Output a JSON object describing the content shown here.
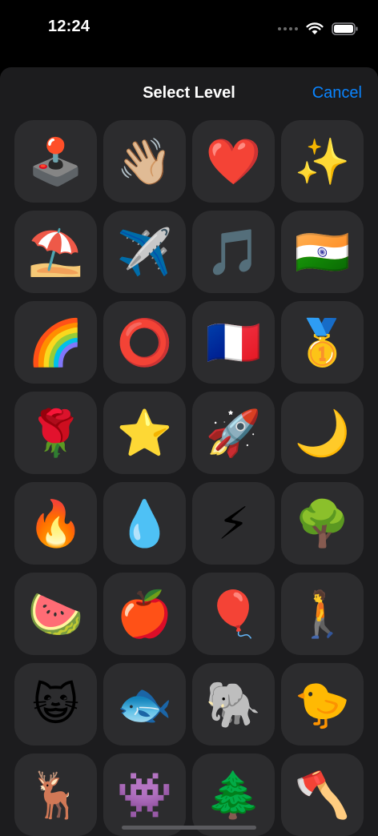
{
  "status_bar": {
    "time": "12:24",
    "icons": [
      "signal-dots-icon",
      "wifi-icon",
      "battery-icon"
    ]
  },
  "sheet": {
    "title": "Select Level",
    "cancel_label": "Cancel",
    "accent_color": "#0a84ff"
  },
  "levels": [
    {
      "emoji": "🕹️",
      "icon": "joystick-icon"
    },
    {
      "emoji": "👋🏼",
      "icon": "waving-hand-icon"
    },
    {
      "emoji": "❤️",
      "icon": "red-heart-icon"
    },
    {
      "emoji": "✨",
      "icon": "sparkles-icon"
    },
    {
      "emoji": "⛱️",
      "icon": "beach-umbrella-icon"
    },
    {
      "emoji": "✈️",
      "icon": "airplane-icon"
    },
    {
      "emoji": "🎵",
      "icon": "musical-note-icon"
    },
    {
      "emoji": "🇮🇳",
      "icon": "india-flag-icon"
    },
    {
      "emoji": "🌈",
      "icon": "rainbow-icon"
    },
    {
      "emoji": "⭕",
      "icon": "red-circle-icon"
    },
    {
      "emoji": "🇫🇷",
      "icon": "france-flag-icon"
    },
    {
      "emoji": "🥇",
      "icon": "gold-medal-icon"
    },
    {
      "emoji": "🌹",
      "icon": "rose-icon"
    },
    {
      "emoji": "⭐",
      "icon": "star-icon"
    },
    {
      "emoji": "🚀",
      "icon": "rocket-icon"
    },
    {
      "emoji": "🌙",
      "icon": "crescent-moon-icon"
    },
    {
      "emoji": "🔥",
      "icon": "fire-icon"
    },
    {
      "emoji": "💧",
      "icon": "droplet-icon"
    },
    {
      "emoji": "⚡",
      "icon": "lightning-icon"
    },
    {
      "emoji": "🌳",
      "icon": "tree-icon"
    },
    {
      "emoji": "🍉",
      "icon": "watermelon-icon"
    },
    {
      "emoji": "🍎",
      "icon": "red-apple-icon"
    },
    {
      "emoji": "🎈",
      "icon": "balloon-icon"
    },
    {
      "emoji": "🚶",
      "icon": "person-walking-icon"
    },
    {
      "emoji": "😺",
      "icon": "grinning-cat-icon"
    },
    {
      "emoji": "🐟",
      "icon": "fish-icon"
    },
    {
      "emoji": "🐘",
      "icon": "elephant-icon"
    },
    {
      "emoji": "🐤",
      "icon": "baby-chick-icon"
    },
    {
      "emoji": "🦌",
      "icon": "deer-icon"
    },
    {
      "emoji": "👾",
      "icon": "alien-monster-icon"
    },
    {
      "emoji": "🌲",
      "icon": "evergreen-tree-icon"
    },
    {
      "emoji": "🪓",
      "icon": "axe-icon"
    }
  ]
}
